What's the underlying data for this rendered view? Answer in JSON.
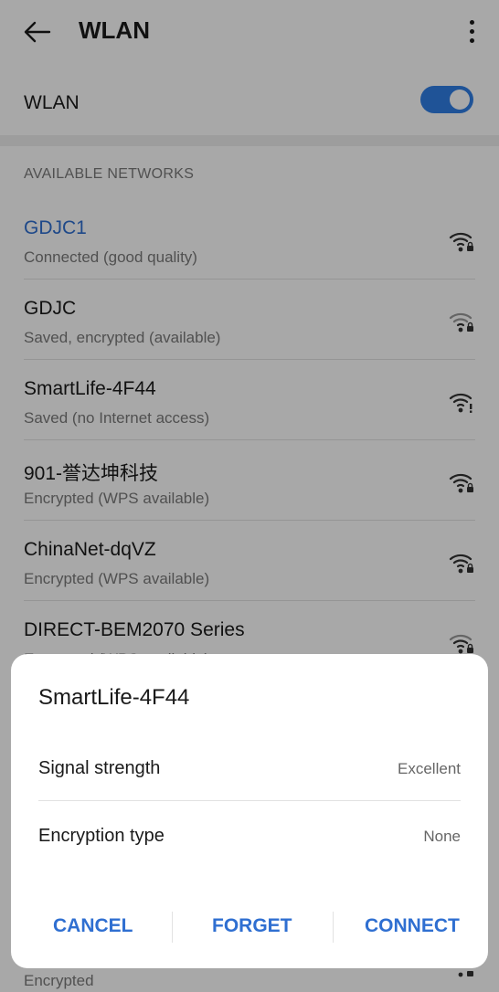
{
  "header": {
    "title": "WLAN"
  },
  "wlan": {
    "label": "WLAN",
    "enabled": true
  },
  "section_title": "AVAILABLE NETWORKS",
  "networks": [
    {
      "name": "GDJC1",
      "status": "Connected (good quality)"
    },
    {
      "name": "GDJC",
      "status": "Saved, encrypted (available)"
    },
    {
      "name": "SmartLife-4F44",
      "status": "Saved (no Internet access)"
    },
    {
      "name": "901-誉达坤科技",
      "status": "Encrypted (WPS available)"
    },
    {
      "name": "ChinaNet-dqVZ",
      "status": "Encrypted (WPS available)"
    },
    {
      "name": "DIRECT-BEM2070 Series",
      "status": "Encrypted (WPS available)"
    },
    {
      "name": "",
      "status": "Encrypted"
    }
  ],
  "dialog": {
    "title": "SmartLife-4F44",
    "rows": [
      {
        "label": "Signal strength",
        "value": "Excellent"
      },
      {
        "label": "Encryption type",
        "value": "None"
      }
    ],
    "buttons": {
      "cancel": "CANCEL",
      "forget": "FORGET",
      "connect": "CONNECT"
    }
  },
  "colors": {
    "accent": "#2f6fd1",
    "toggle": "#2f7fe6",
    "text": "#1a1a1a",
    "secondary": "#7a7a7a"
  },
  "icons": [
    "back-arrow-icon",
    "more-vert-icon",
    "wifi-locked-icon",
    "wifi-warning-icon"
  ]
}
